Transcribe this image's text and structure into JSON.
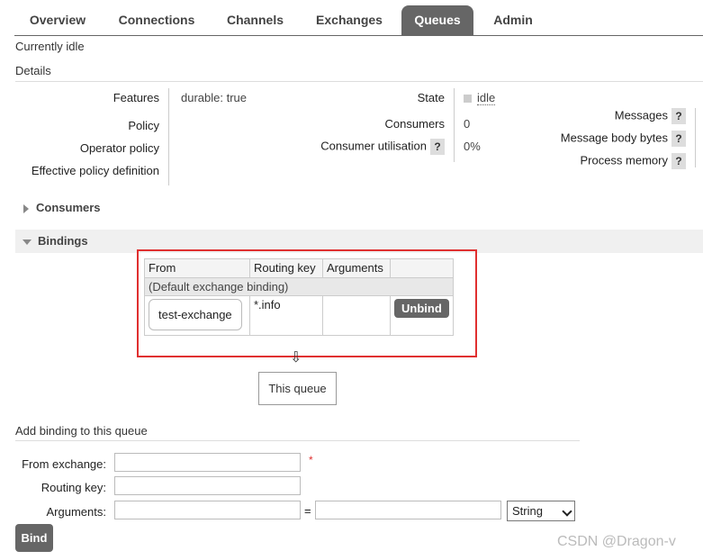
{
  "nav": {
    "tabs": [
      "Overview",
      "Connections",
      "Channels",
      "Exchanges",
      "Queues",
      "Admin"
    ],
    "active": "Queues"
  },
  "status": "Currently idle",
  "details": {
    "heading": "Details",
    "features_label": "Features",
    "features_key": "durable:",
    "features_value": "true",
    "policy_label": "Policy",
    "operator_policy_label": "Operator policy",
    "effective_policy_label": "Effective policy definition",
    "state_label": "State",
    "state_value": "idle",
    "consumers_label": "Consumers",
    "consumers_value": "0",
    "consumer_util_label": "Consumer utilisation",
    "consumer_util_value": "0%",
    "messages_label": "Messages",
    "message_body_bytes_label": "Message body bytes",
    "process_memory_label": "Process memory",
    "help_glyph": "?"
  },
  "sections": {
    "consumers": "Consumers",
    "bindings": "Bindings"
  },
  "bindings_table": {
    "headers": [
      "From",
      "Routing key",
      "Arguments",
      ""
    ],
    "default_row": "(Default exchange binding)",
    "rows": [
      {
        "from": "test-exchange",
        "routing_key": "*.info",
        "arguments": "",
        "action": "Unbind"
      }
    ]
  },
  "this_queue": "This queue",
  "arrow_glyph": "⇩",
  "add_binding": {
    "heading": "Add binding to this queue",
    "from_exchange_label": "From exchange:",
    "routing_key_label": "Routing key:",
    "arguments_label": "Arguments:",
    "required_mark": "*",
    "equals": "=",
    "type_selected": "String",
    "bind_button": "Bind"
  },
  "watermark": "CSDN @Dragon-v",
  "colors": {
    "tab_active": "#666666",
    "highlight_box": "#e03030",
    "button": "#666666"
  }
}
